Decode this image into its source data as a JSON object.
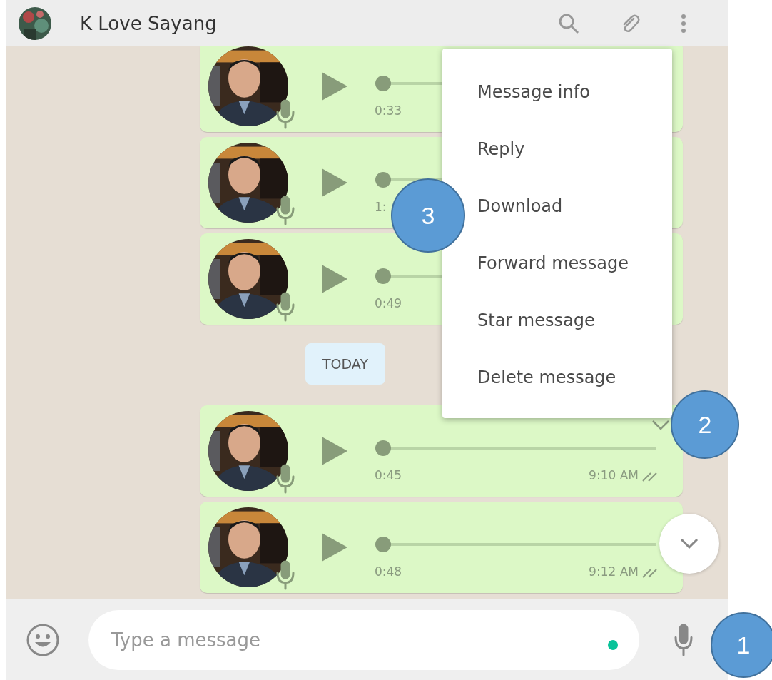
{
  "header": {
    "contact_name": "K Love Sayang"
  },
  "messages": [
    {
      "kind": "audio",
      "duration": "0:33",
      "level": 0
    },
    {
      "kind": "audio",
      "duration": "1:",
      "level": 0
    },
    {
      "kind": "audio",
      "duration": "0:49",
      "level": 0
    },
    {
      "kind": "date",
      "label": "TODAY"
    },
    {
      "kind": "audio",
      "duration": "0:45",
      "time": "9:10 AM",
      "read": false,
      "menu_open": true,
      "level": 0
    },
    {
      "kind": "audio",
      "duration": "0:48",
      "time": "9:12 AM",
      "read": false,
      "level": 0
    }
  ],
  "context_menu": {
    "items": [
      "Message info",
      "Reply",
      "Download",
      "Forward message",
      "Star message",
      "Delete message"
    ]
  },
  "composer": {
    "placeholder": "Type a message"
  },
  "annotations": [
    {
      "label": "3"
    },
    {
      "label": "2"
    },
    {
      "label": "1"
    }
  ]
}
